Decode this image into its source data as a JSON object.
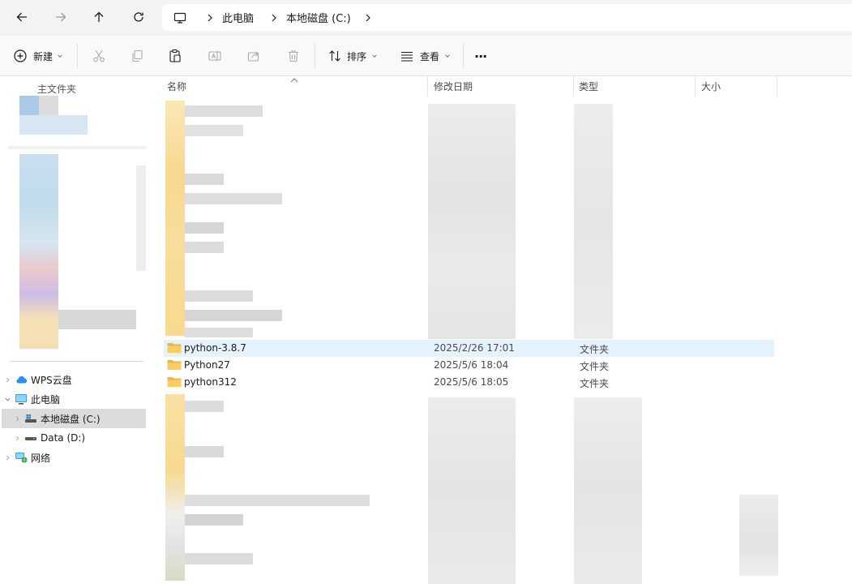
{
  "address": {
    "segments": [
      "此电脑",
      "本地磁盘 (C:)"
    ]
  },
  "toolbar": {
    "new_label": "新建",
    "sort_label": "排序",
    "view_label": "查看",
    "more_label": "···"
  },
  "sidebar": {
    "quick_access_label": "主文件夹",
    "items": [
      {
        "label": "WPS云盘",
        "icon": "cloud-icon"
      },
      {
        "label": "此电脑",
        "icon": "computer-icon"
      },
      {
        "label": "本地磁盘 (C:)",
        "icon": "drive-c-icon"
      },
      {
        "label": "Data (D:)",
        "icon": "drive-d-icon"
      },
      {
        "label": "网络",
        "icon": "network-icon"
      }
    ]
  },
  "columns": {
    "name": "名称",
    "date": "修改日期",
    "type": "类型",
    "size": "大小"
  },
  "files": [
    {
      "name": "python-3.8.7",
      "date": "2025/2/26 17:01",
      "type": "文件夹"
    },
    {
      "name": "Python27",
      "date": "2025/5/6 18:04",
      "type": "文件夹"
    },
    {
      "name": "python312",
      "date": "2025/5/6 18:05",
      "type": "文件夹"
    }
  ],
  "colors": {
    "accent": "#0067c0",
    "folder_yellow": "#f8c85a",
    "hover_row": "#e5f3fe",
    "selected_sidebar": "#dcdcdc"
  }
}
